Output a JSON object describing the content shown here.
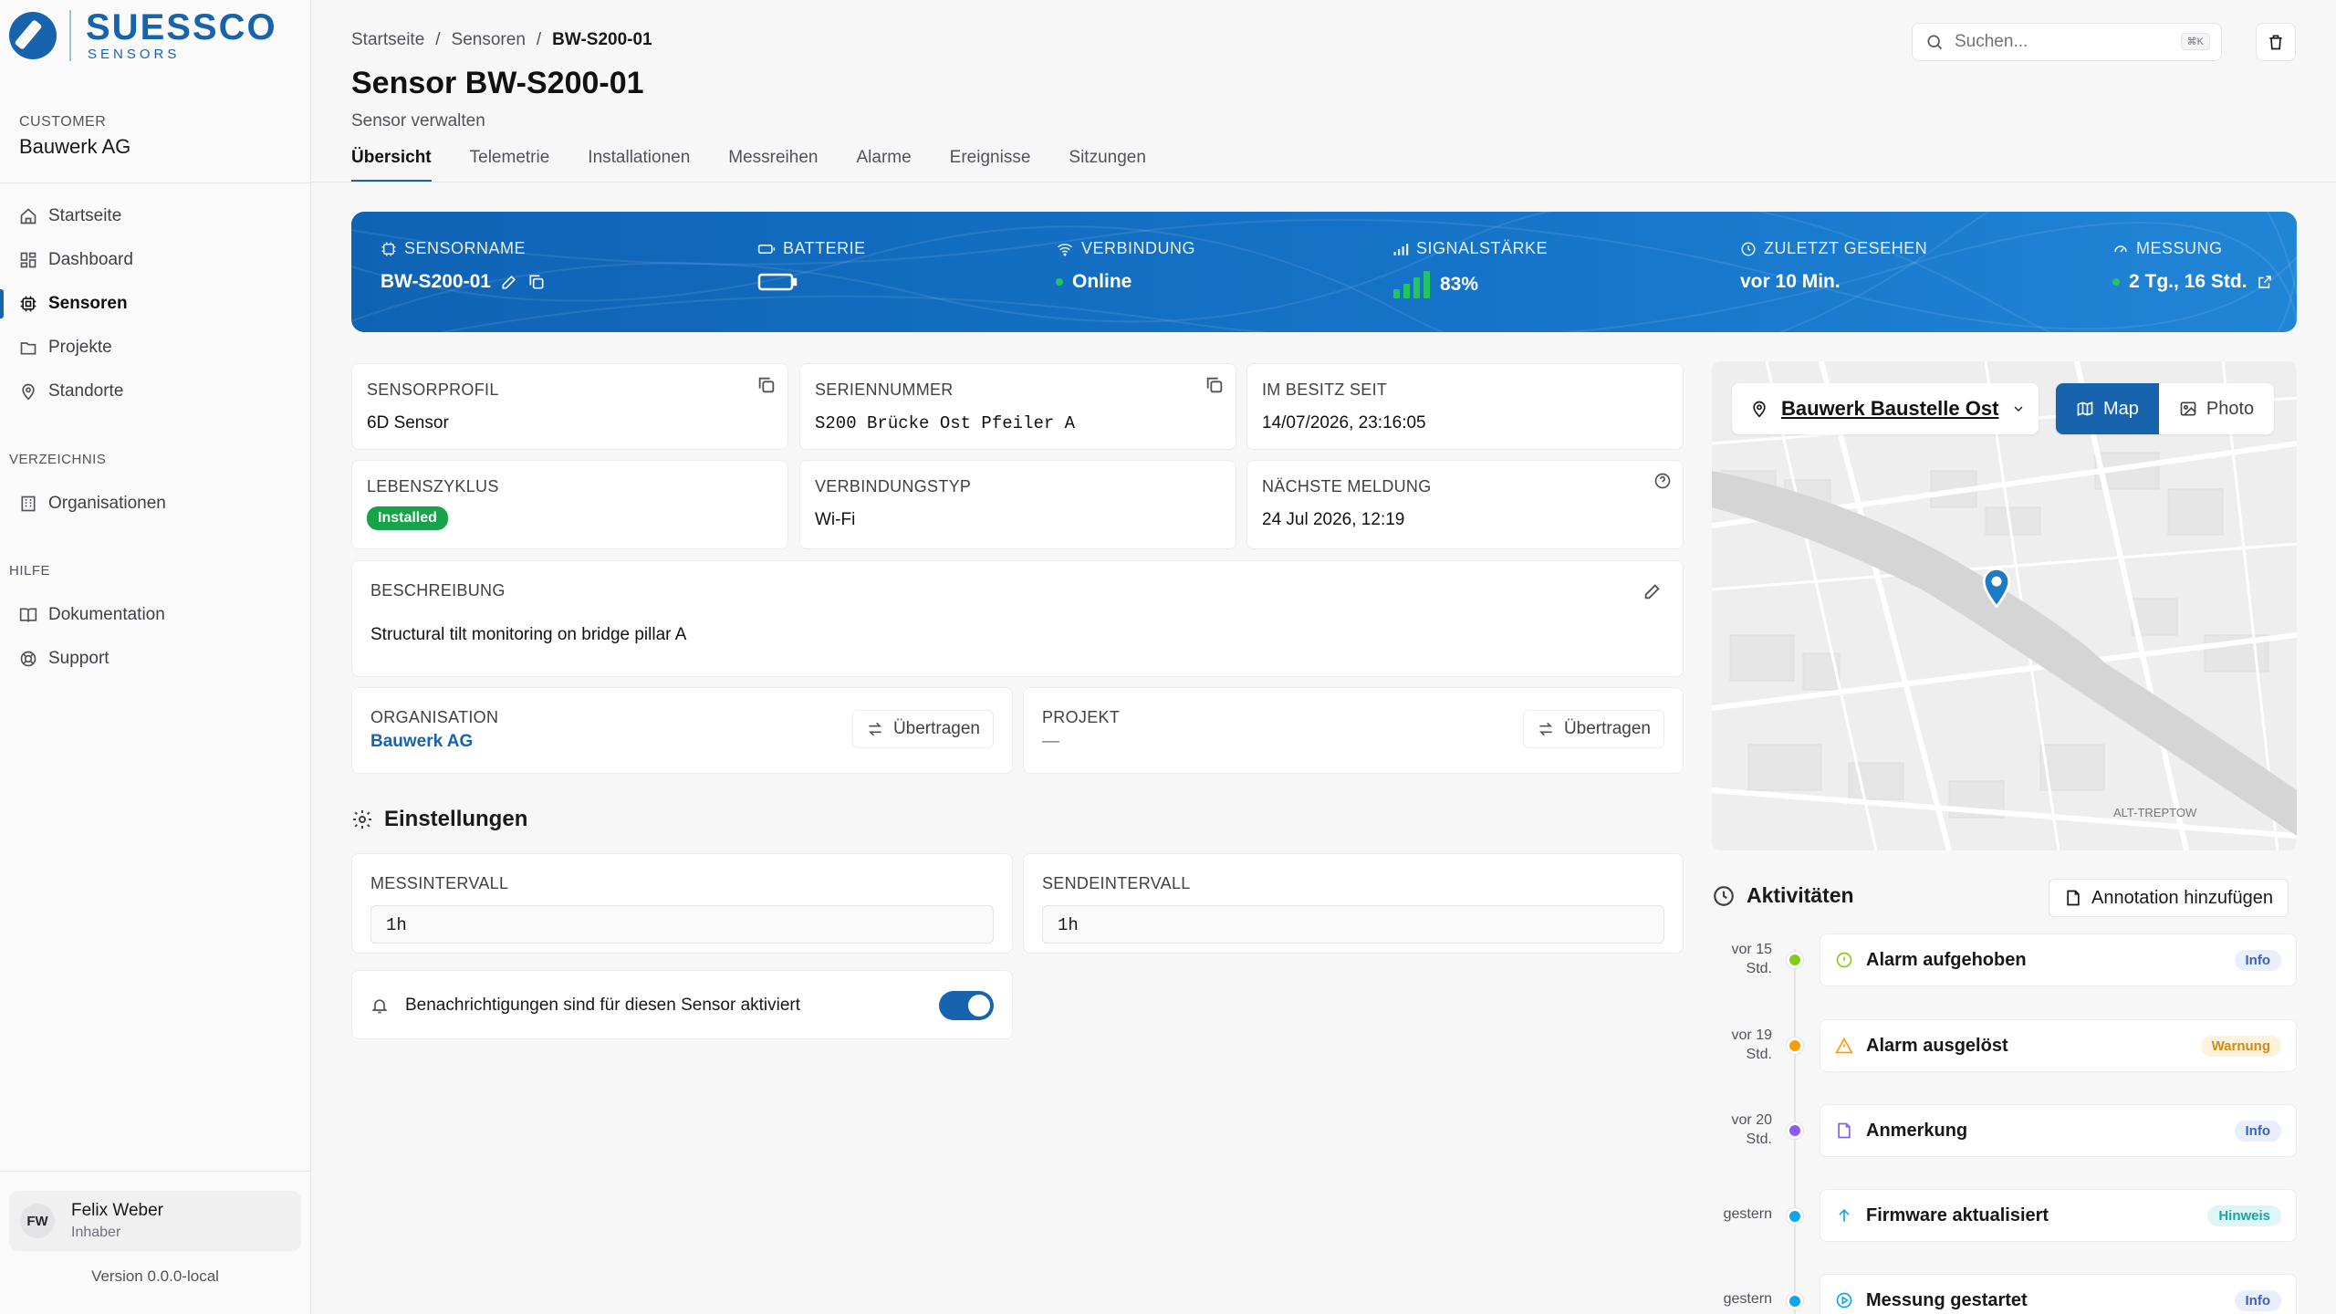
{
  "brand": {
    "name": "SUESSCO",
    "sub": "SENSORS"
  },
  "customer": {
    "label": "CUSTOMER",
    "name": "Bauwerk AG"
  },
  "nav": {
    "main": [
      {
        "label": "Startseite",
        "icon": "home-icon"
      },
      {
        "label": "Dashboard",
        "icon": "grid-icon"
      },
      {
        "label": "Sensoren",
        "icon": "chip-icon",
        "active": true
      },
      {
        "label": "Projekte",
        "icon": "folder-icon"
      },
      {
        "label": "Standorte",
        "icon": "pin-icon"
      }
    ],
    "directory_label": "VERZEICHNIS",
    "directory": [
      {
        "label": "Organisationen",
        "icon": "building-icon"
      }
    ],
    "help_label": "HILFE",
    "help": [
      {
        "label": "Dokumentation",
        "icon": "book-icon"
      },
      {
        "label": "Support",
        "icon": "lifebuoy-icon"
      }
    ]
  },
  "user": {
    "initials": "FW",
    "name": "Felix Weber",
    "role": "Inhaber"
  },
  "version": "Version 0.0.0-local",
  "breadcrumb": {
    "home": "Startseite",
    "section": "Sensoren",
    "current": "BW-S200-01",
    "sep": "/"
  },
  "page": {
    "title": "Sensor BW-S200-01",
    "subtitle": "Sensor verwalten"
  },
  "search": {
    "placeholder": "Suchen...",
    "shortcut": "⌘K"
  },
  "tabs": [
    "Übersicht",
    "Telemetrie",
    "Installationen",
    "Messreihen",
    "Alarme",
    "Ereignisse",
    "Sitzungen"
  ],
  "banner": {
    "sensorname_label": "SENSORNAME",
    "sensorname": "BW-S200-01",
    "battery_label": "BATTERIE",
    "connection_label": "VERBINDUNG",
    "connection": "Online",
    "signal_label": "SIGNALSTÄRKE",
    "signal": "83%",
    "lastseen_label": "ZULETZT GESEHEN",
    "lastseen": "vor 10 Min.",
    "measurement_label": "MESSUNG",
    "measurement": "2 Tg., 16 Std."
  },
  "details": {
    "profile_label": "SENSORPROFIL",
    "profile": "6D Sensor",
    "serial_label": "SERIENNUMMER",
    "serial": "S200 Brücke Ost Pfeiler A",
    "owned_label": "IM BESITZ SEIT",
    "owned": "14/07/2026, 23:16:05",
    "lifecycle_label": "LEBENSZYKLUS",
    "lifecycle": "Installed",
    "conn_type_label": "VERBINDUNGSTYP",
    "conn_type": "Wi-Fi",
    "next_label": "NÄCHSTE MELDUNG",
    "next": "24 Jul 2026, 12:19",
    "desc_label": "BESCHREIBUNG",
    "desc": "Structural tilt monitoring on bridge pillar A",
    "org_label": "ORGANISATION",
    "org": "Bauwerk AG",
    "project_label": "PROJEKT",
    "project": "—",
    "transfer": "Übertragen"
  },
  "settings": {
    "title": "Einstellungen",
    "measure_label": "MESSINTERVALL",
    "measure": "1h",
    "send_label": "SENDEINTERVALL",
    "send": "1h",
    "notify": "Benachrichtigungen sind für diesen Sensor aktiviert"
  },
  "map": {
    "location": "Bauwerk Baustelle Ost",
    "map_btn": "Map",
    "photo_btn": "Photo",
    "label_district": "ALT-TREPTOW"
  },
  "activities": {
    "title": "Aktivitäten",
    "add": "Annotation hinzufügen",
    "items": [
      {
        "time1": "vor 15",
        "time2": "Std.",
        "title": "Alarm aufgehoben",
        "badge": "Info",
        "kind": "info",
        "color": "#84cc16"
      },
      {
        "time1": "vor 19",
        "time2": "Std.",
        "title": "Alarm ausgelöst",
        "badge": "Warnung",
        "kind": "warn",
        "color": "#f59e0b"
      },
      {
        "time1": "vor 20",
        "time2": "Std.",
        "title": "Anmerkung",
        "badge": "Info",
        "kind": "info",
        "color": "#8b5cf6"
      },
      {
        "time1": "gestern",
        "time2": "",
        "title": "Firmware aktualisiert",
        "badge": "Hinweis",
        "kind": "hint",
        "color": "#0ea5e9"
      },
      {
        "time1": "gestern",
        "time2": "",
        "title": "Messung gestartet",
        "badge": "Info",
        "kind": "info",
        "color": "#0ea5e9"
      }
    ]
  }
}
